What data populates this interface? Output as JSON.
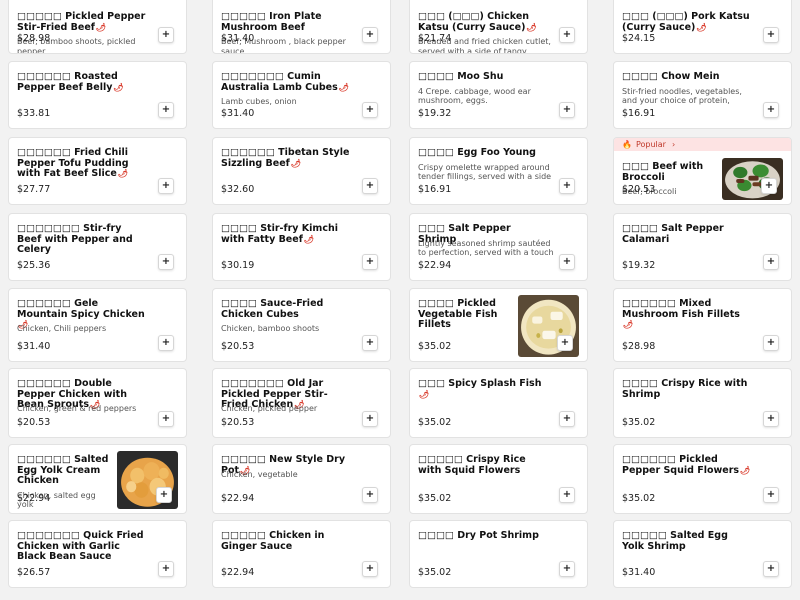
{
  "menu": {
    "col1": [
      {
        "title": "□□□□□ Pickled Pepper Stir-Fried Beef",
        "chili": true,
        "desc": "Beef, bamboo shoots, pickled pepper",
        "price": "$28.98"
      },
      {
        "title": "□□□□□□ Roasted Pepper Beef Belly",
        "chili": true,
        "desc": "",
        "price": "$33.81"
      },
      {
        "title": "□□□□□□ Fried Chili Pepper Tofu Pudding with Fat Beef Slice",
        "chili": true,
        "desc": "",
        "price": "$27.77"
      },
      {
        "title": "□□□□□□□ Stir-fry Beef with Pepper and Celery",
        "chili": false,
        "desc": "",
        "price": "$25.36"
      },
      {
        "title": "□□□□□□ Gele Mountain Spicy Chicken",
        "chili": true,
        "desc": "Chicken, Chili peppers",
        "price": "$31.40"
      },
      {
        "title": "□□□□□□ Double Pepper Chicken with Bean Sprouts",
        "chili": true,
        "desc": "Chicken, green & red peppers",
        "price": "$20.53"
      },
      {
        "title": "□□□□□□ Salted Egg Yolk Cream Chicken",
        "chili": false,
        "desc": "Chicken, salted egg yolk",
        "price": "$22.94",
        "image": "salted-egg-chicken"
      },
      {
        "title": "□□□□□□□ Quick Fried Chicken with Garlic Black Bean Sauce",
        "chili": false,
        "desc": "",
        "price": "$26.57"
      }
    ],
    "col2": [
      {
        "title": "□□□□□ Iron Plate Mushroom Beef",
        "chili": false,
        "desc": "Beef, Mushroom , black pepper sauce",
        "price": "$31.40"
      },
      {
        "title": "□□□□□□□ Cumin Australia Lamb Cubes",
        "chili": true,
        "desc": "Lamb cubes, onion",
        "price": "$31.40"
      },
      {
        "title": "□□□□□□ Tibetan Style Sizzling Beef",
        "chili": true,
        "desc": "",
        "price": "$32.60"
      },
      {
        "title": "□□□□ Stir-fry Kimchi with Fatty Beef",
        "chili": true,
        "desc": "",
        "price": "$30.19"
      },
      {
        "title": "□□□□ Sauce-Fried Chicken Cubes",
        "chili": false,
        "desc": "Chicken, bamboo shoots",
        "price": "$20.53"
      },
      {
        "title": "□□□□□□□ Old Jar Pickled Pepper Stir-Fried Chicken",
        "chili": true,
        "desc": "Chicken, pickled pepper",
        "price": "$20.53"
      },
      {
        "title": "□□□□□ New Style Dry Pot",
        "chili": true,
        "desc": "Chicken, vegetable",
        "price": "$22.94"
      },
      {
        "title": "□□□□□ Chicken in Ginger Sauce",
        "chili": false,
        "desc": "",
        "price": "$22.94"
      }
    ],
    "col3": [
      {
        "title": "□□□ (□□□) Chicken Katsu (Curry Sauce)",
        "chili": true,
        "desc": "Breaded and fried chicken cutlet, served with a side of tangy dipping...",
        "price": "$21.74"
      },
      {
        "title": "□□□□ Moo Shu",
        "chili": false,
        "desc": "4 Crepe. cabbage, wood ear mushroom, eggs.",
        "price": "$19.32"
      },
      {
        "title": "□□□□ Egg Foo Young",
        "chili": false,
        "desc": "Crispy omelette wrapped around tender fillings, served with a side o...",
        "price": "$16.91"
      },
      {
        "title": "□□□ Salt Pepper Shrimp",
        "chili": false,
        "desc": "Lightly seasoned shrimp sautéed to perfection, served with a touch of...",
        "price": "$22.94"
      },
      {
        "title": "□□□□ Pickled Vegetable Fish Fillets",
        "chili": false,
        "desc": "",
        "price": "$35.02",
        "image": "fish-fillets"
      },
      {
        "title": "□□□ Spicy Splash Fish",
        "chili": true,
        "desc": "",
        "price": "$35.02"
      },
      {
        "title": "□□□□□ Crispy Rice with Squid Flowers",
        "chili": false,
        "desc": "",
        "price": "$35.02"
      },
      {
        "title": "□□□□ Dry Pot Shrimp",
        "chili": false,
        "desc": "",
        "price": "$35.02"
      }
    ],
    "col4": [
      {
        "title": "□□□ (□□□) Pork Katsu (Curry Sauce)",
        "chili": true,
        "desc": "",
        "price": "$24.15"
      },
      {
        "title": "□□□□ Chow Mein",
        "chili": false,
        "desc": "Stir-fried noodles, vegetables, and your choice of protein, served in a...",
        "price": "$16.91"
      },
      {
        "title": "□□□ Beef with Broccoli",
        "chili": false,
        "desc": "Beef, broccoli",
        "price": "$20.53",
        "popular": "Popular",
        "image": "beef-broccoli"
      },
      {
        "title": "□□□□ Salt Pepper Calamari",
        "chili": false,
        "desc": "",
        "price": "$19.32"
      },
      {
        "title": "□□□□□□ Mixed Mushroom Fish Fillets",
        "chili": true,
        "desc": "",
        "price": "$28.98"
      },
      {
        "title": "□□□□ Crispy Rice with Shrimp",
        "chili": false,
        "desc": "",
        "price": "$35.02"
      },
      {
        "title": "□□□□□□ Pickled Pepper Squid Flowers",
        "chili": true,
        "desc": "",
        "price": "$35.02"
      },
      {
        "title": "□□□□□ Salted Egg Yolk Shrimp",
        "chili": false,
        "desc": "",
        "price": "$31.40"
      }
    ]
  },
  "ui": {
    "add_label": "+",
    "chili_glyph": "🌶",
    "popular_icon": "🔥",
    "chevron": "›"
  },
  "colors": {
    "accent": "#d93a2b",
    "popular_bg": "#fde3e3"
  }
}
